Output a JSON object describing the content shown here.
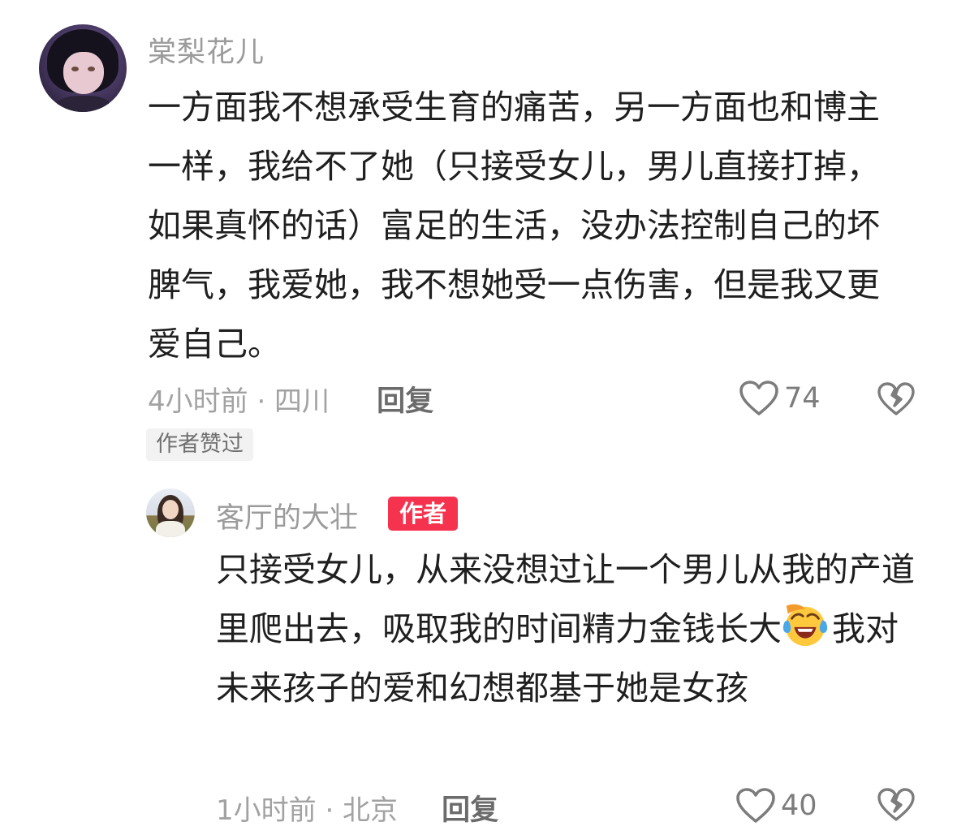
{
  "comment": {
    "username": "棠梨花儿",
    "text": "一方面我不想承受生育的痛苦，另一方面也和博主一样，我给不了她（只接受女儿，男儿直接打掉，如果真怀的话）富足的生活，没办法控制自己的坏脾气，我爱她，我不想她受一点伤害，但是我又更爱自己。",
    "meta": "4小时前 · 四川",
    "reply_label": "回复",
    "like_count": "74",
    "author_liked_badge": "作者赞过",
    "icons": {
      "like": "heart-outline-icon",
      "dislike": "broken-heart-icon"
    }
  },
  "reply": {
    "username": "客厅的大壮",
    "author_tag": "作者",
    "emoji": "face-with-tears-of-joy-icon",
    "text_before_emoji": "只接受女儿，从来没想过让一个男儿从我的产道里爬出去，吸取我的时间精力金钱长大",
    "text_after_emoji": "我对未来孩子的爱和幻想都基于她是女孩",
    "meta": "1小时前 · 北京",
    "reply_label": "回复",
    "like_count": "40"
  },
  "colors": {
    "background": "#ffffff",
    "text": "#1f1f1f",
    "muted": "#9b9b9b",
    "author_tag_bg": "#f6334f",
    "badge_bg": "#f2f2f2"
  }
}
